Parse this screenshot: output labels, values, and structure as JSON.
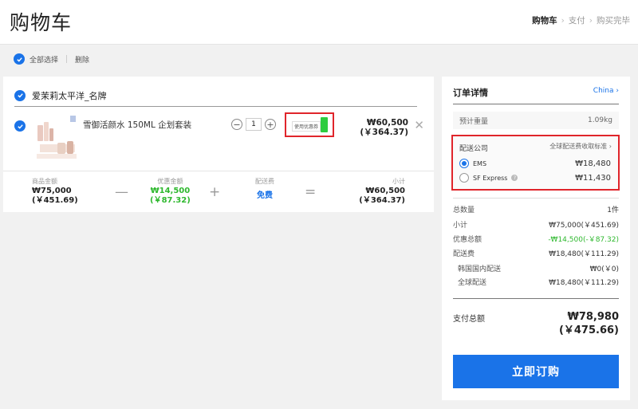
{
  "header": {
    "title": "购物车",
    "steps": [
      "购物车",
      "支付",
      "购买完毕"
    ]
  },
  "toolbar": {
    "select_all": "全部选择",
    "delete": "删除"
  },
  "cart": {
    "store_name": "爱茉莉太平洋_名牌",
    "item": {
      "name": "雪御活颜水 150ML 企划套装",
      "quantity": "1",
      "coupon_label": "使用优惠券",
      "price_krw": "₩60,500",
      "price_cny": "(￥364.37)"
    },
    "summary": {
      "goods_label": "商品金额",
      "goods_krw": "₩75,000",
      "goods_cny": "(￥451.69)",
      "discount_label": "优惠金额",
      "discount_krw": "₩14,500",
      "discount_cny": "(￥87.32)",
      "shipping_label": "配送费",
      "shipping_value": "免费",
      "subtotal_label": "小计",
      "subtotal_krw": "₩60,500",
      "subtotal_cny": "(￥364.37)"
    }
  },
  "order": {
    "title": "订单详情",
    "country": "China",
    "weight_label": "预计重量",
    "weight_value": "1.09kg",
    "shipping_company_label": "配送公司",
    "shipping_standard_link": "全球配送费收取标准",
    "options": [
      {
        "name": "EMS",
        "price": "₩18,480",
        "selected": true
      },
      {
        "name": "SF Express",
        "price": "₩11,430",
        "selected": false
      }
    ],
    "rows": [
      {
        "label": "总数量",
        "value": "1件"
      },
      {
        "label": "小计",
        "value": "₩75,000(￥451.69)"
      },
      {
        "label": "优惠总额",
        "value": "-₩14,500(-￥87.32)"
      },
      {
        "label": "配送费",
        "value": "₩18,480(￥111.29)"
      },
      {
        "label": "韩国国内配送",
        "value": "₩0(￥0)"
      },
      {
        "label": "全球配送",
        "value": "₩18,480(￥111.29)"
      }
    ],
    "total_label": "支付总额",
    "total_krw": "₩78,980",
    "total_cny": "(￥475.66)",
    "buy_button": "立即订购"
  },
  "colors": {
    "accent": "#1a73e8",
    "highlight_border": "#e0252b",
    "discount_green": "#2eb82e"
  }
}
